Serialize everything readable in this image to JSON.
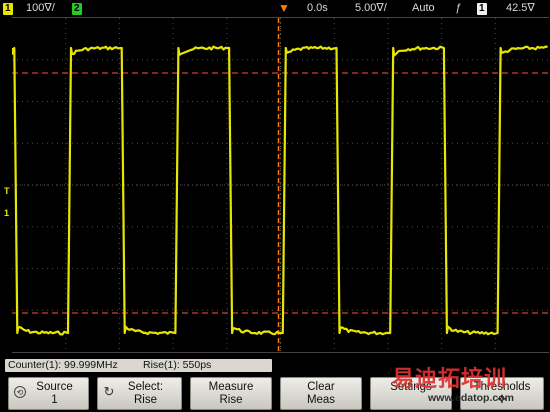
{
  "colors": {
    "channel1": "#e6e600",
    "channel2": "#22cc22",
    "trigger_marker": "#ff7a00",
    "cursor_lines": "#d0452a",
    "grid": "#4a4a4a",
    "softkey_bg": "#dcdad2"
  },
  "status_bar": {
    "channel1_num": "1",
    "channel1_scale": "100∇/",
    "channel2_num": "2",
    "time_delay": "0.0s",
    "time_scale": "5.00∇/",
    "trigger_mode": "Auto",
    "trigger_slope_icon": "rising-edge-icon",
    "trigger_slope_glyph": "ƒ",
    "trigger_source": "1",
    "trigger_level": "42.5∇"
  },
  "markers": {
    "trigger_level": "T",
    "channel1_ground": "1"
  },
  "measurements": [
    {
      "label": "Counter(1): 99.999MHz"
    },
    {
      "label": "Rise(1): 550ps"
    }
  ],
  "softkeys": [
    {
      "line1": "Source",
      "line2": "1",
      "icon": "rotary-knob-icon"
    },
    {
      "line1": "Select:",
      "line2": "Rise",
      "icon": "refresh-arrow-icon"
    },
    {
      "line1": "Measure",
      "line2": "Rise",
      "icon": ""
    },
    {
      "line1": "Clear",
      "line2": "Meas",
      "icon": ""
    },
    {
      "line1": "Settings",
      "line2": "",
      "icon": ""
    },
    {
      "line1": "Thresholds",
      "line2": "✛",
      "icon": ""
    }
  ],
  "watermark": {
    "brand": "易迪拓培训",
    "url": "www.edatop.com"
  }
}
